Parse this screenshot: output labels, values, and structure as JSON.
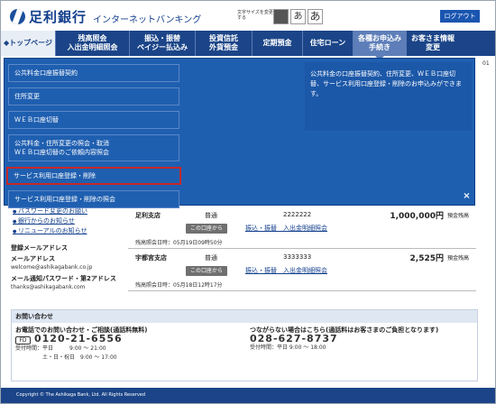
{
  "header": {
    "bank_name": "足利銀行",
    "service_name": "インターネットバンキング",
    "font_size_label": "文字サイズを変更する",
    "font_sizes": [
      "",
      "あ",
      "あ"
    ],
    "logout_label": "ログアウト"
  },
  "nav": {
    "items": [
      {
        "label1": "トップページ",
        "label2": ""
      },
      {
        "label1": "残高照会",
        "label2": "入出金明細照会"
      },
      {
        "label1": "振込・振替",
        "label2": "ペイジー払込み"
      },
      {
        "label1": "投資信託",
        "label2": "外貨預金"
      },
      {
        "label1": "定期預金",
        "label2": ""
      },
      {
        "label1": "住宅ローン",
        "label2": ""
      },
      {
        "label1": "各種お申込み",
        "label2": "手続き"
      },
      {
        "label1": "お客さま情報",
        "label2": "変更"
      }
    ],
    "home_prefix": "◆"
  },
  "dropdown": {
    "items": [
      {
        "label1": "公共料金口座振替契約",
        "label2": ""
      },
      {
        "label1": "住所変更",
        "label2": ""
      },
      {
        "label1": "ＷＥＢ口座切替",
        "label2": ""
      },
      {
        "label1": "公共料金・住所変更の照会・取消",
        "label2": "ＷＥＢ口座切替のご依頼内容照会"
      },
      {
        "label1": "サービス利用口座登録・削除",
        "label2": ""
      },
      {
        "label1": "サービス利用口座登録・削除の照会",
        "label2": ""
      }
    ],
    "description": "公共料金の口座振替契約、住所変更、ＷＥＢ口座切替、サービス利用口座登録・削除のお申込みができます。",
    "close_label": "×",
    "partial_text": "01"
  },
  "links": [
    "パスワード変更のお願い",
    "銀行からのお知らせ",
    "リニューアルのお知らせ"
  ],
  "registered": {
    "title": "登録メールアドレス",
    "mail_label": "メールアドレス",
    "mail_value": "welcome@ashikagabank.co.jp",
    "notify_label": "メール通知パスワード・第2アドレス",
    "notify_value": "thanks@ashikagabank.com"
  },
  "accounts": [
    {
      "branch": "足利支店",
      "type": "普通",
      "number": "2222222",
      "balance": "1,000,000円",
      "balance_label": "預金残高",
      "pill": "この口座から",
      "link": "振込・振替　入出金明細照会",
      "updated": "残高照会日時：05月19日09時50分"
    },
    {
      "branch": "宇都宮支店",
      "type": "普通",
      "number": "3333333",
      "balance": "2,525円",
      "balance_label": "預金残高",
      "pill": "この口座から",
      "link": "振込・振替　入出金明細照会",
      "updated": "残高照会日時：05月18日12時17分"
    }
  ],
  "inquiry": {
    "title": "お問い合わせ",
    "left_head": "お電話でのお問い合わせ・ご相談(通話料無料)",
    "freedial_mark": "FD",
    "phone": "0120-21-6556",
    "hours1": "受付時間：平日　　　9:00 ～ 21:00",
    "hours2": "　　　　　土・日・祝日　9:00 ～ 17:00",
    "right_head": "つながらない場合はこちら(通話料はお客さまのご負担となります)",
    "phone2": "028-627-8737",
    "hours3": "受付時間：平日 9:00 ～ 18:00"
  },
  "footer": {
    "copyright": "Copyright © The Ashikaga Bank, Ltd. All Rights Reserved"
  }
}
